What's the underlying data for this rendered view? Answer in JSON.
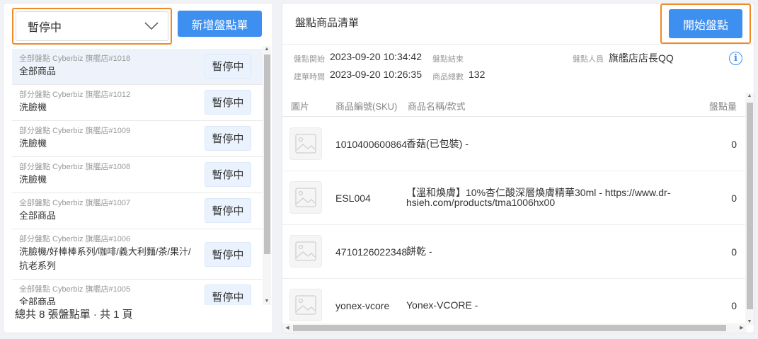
{
  "left": {
    "status_select": {
      "value": "暫停中"
    },
    "new_button": "新增盤點單",
    "items": [
      {
        "meta": "全部盤點 Cyberbiz 旗艦店#1018",
        "name": "全部商品",
        "action": "暫停中"
      },
      {
        "meta": "部分盤點 Cyberbiz 旗艦店#1012",
        "name": "洗臉機",
        "action": "暫停中"
      },
      {
        "meta": "部分盤點 Cyberbiz 旗艦店#1009",
        "name": "洗臉機",
        "action": "暫停中"
      },
      {
        "meta": "部分盤點 Cyberbiz 旗艦店#1008",
        "name": "洗臉機",
        "action": "暫停中"
      },
      {
        "meta": "全部盤點 Cyberbiz 旗艦店#1007",
        "name": "全部商品",
        "action": "暫停中"
      },
      {
        "meta": "部分盤點 Cyberbiz 旗艦店#1006",
        "name": "洗臉機/好棒棒系列/咖啡/義大利麵/茶/果汁/抗老系列",
        "action": "暫停中"
      },
      {
        "meta": "全部盤點 Cyberbiz 旗艦店#1005",
        "name": "全部商品",
        "action": "暫停中"
      }
    ],
    "footer": "總共 8 張盤點單 · 共 1 頁"
  },
  "right": {
    "title": "盤點商品清單",
    "start_button": "開始盤點",
    "info": {
      "start_label": "盤點開始",
      "start_value": "2023-09-20 10:34:42",
      "end_label": "盤點結束",
      "end_value": "",
      "staff_label": "盤點人員",
      "staff_value": "旗艦店店長QQ",
      "created_label": "建單時間",
      "created_value": "2023-09-20 10:26:35",
      "total_label": "商品總數",
      "total_value": "132"
    },
    "table": {
      "headers": {
        "image": "圖片",
        "sku": "商品編號(SKU)",
        "name": "商品名稱/款式",
        "qty": "盤點量"
      },
      "rows": [
        {
          "sku": "1010400600864",
          "name": "香菇(已包裝) -",
          "qty": "0"
        },
        {
          "sku": "ESL004",
          "name": "【溫和煥膚】10%杏仁酸深層煥膚精華30ml - https://www.dr-hsieh.com/products/tma1006hx00",
          "qty": "0"
        },
        {
          "sku": "4710126022348",
          "name": "餅乾 -",
          "qty": "0"
        },
        {
          "sku": "yonex-vcore",
          "name": "Yonex-VCORE -",
          "qty": "0"
        }
      ]
    }
  }
}
